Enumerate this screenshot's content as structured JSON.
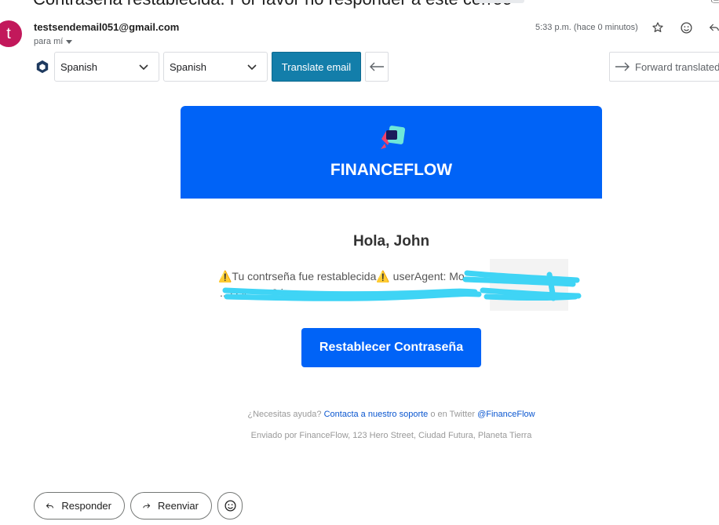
{
  "email": {
    "subject": "Contraseña restablecida. Por favor no responder a este correo",
    "sender_initial": "t",
    "sender": "testsendemail051@gmail.com",
    "recipient": "para mí",
    "time": "5:33 p.m. (hace 0 minutos)"
  },
  "translate_bar": {
    "source_language": "Spanish",
    "target_language": "Spanish",
    "translate_label": "Translate email",
    "forward_label": "Forward translated"
  },
  "body": {
    "brand_name": "FINANCEFLOW",
    "greeting": "Hola, John",
    "reset_line1": "⚠️Tu contrseña fue restablecida⚠️ userAgent: Mo",
    "reset_line2": "...) Ge... ...0 ip:",
    "cta_label": "Restablecer Contraseña",
    "help_prefix": "¿Necesitas ayuda?",
    "help_link": "Contacta a nuestro soporte",
    "help_middle": "o en Twitter",
    "twitter_link": "@FinanceFlow",
    "sent_by": "Enviado por FinanceFlow, 123 Hero Street, Ciudad Futura, Planeta Tierra",
    "brand_colors": {
      "banner": "#0063f7",
      "redaction": "#3fd4f5"
    }
  },
  "actions": {
    "reply_label": "Responder",
    "forward_label": "Reenviar"
  }
}
